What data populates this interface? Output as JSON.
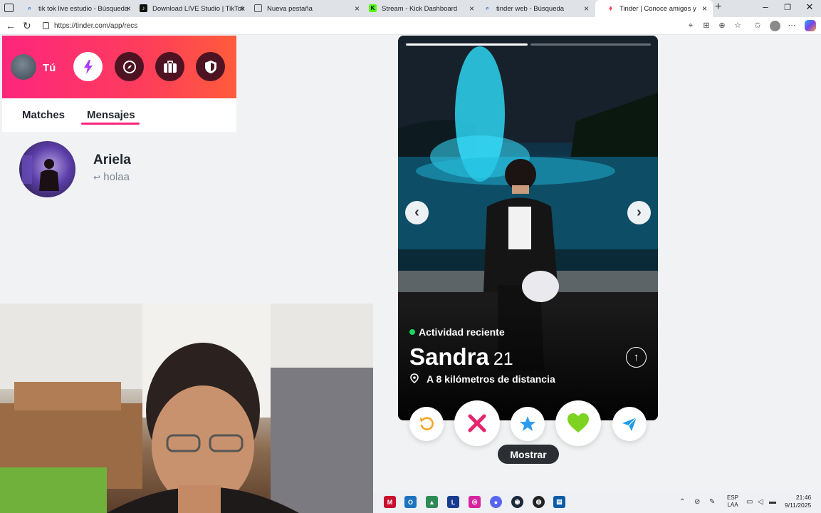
{
  "browser": {
    "tabs": [
      {
        "title": "tik tok live estudio - Búsqueda",
        "icon": "search-icon"
      },
      {
        "title": "Download LIVE Studio | TikTok",
        "icon": "tiktok-icon"
      },
      {
        "title": "Nueva pestaña",
        "icon": "page-icon"
      },
      {
        "title": "Stream - Kick Dashboard",
        "icon": "kick-icon"
      },
      {
        "title": "tinder web - Búsqueda",
        "icon": "search-icon"
      },
      {
        "title": "Tinder | Conoce amigos y gente n",
        "icon": "tinder-icon"
      }
    ],
    "url": "https://tinder.com/app/recs",
    "new_tab": "+",
    "close": "×"
  },
  "sidebar": {
    "user_label": "Tú",
    "tabs": [
      {
        "label": "Matches"
      },
      {
        "label": "Mensajes"
      }
    ],
    "active_tab": "Mensajes",
    "messages": [
      {
        "name": "Ariela",
        "preview": "holaa",
        "reply_icon": "↩"
      }
    ]
  },
  "card": {
    "activity": "Actividad reciente",
    "name": "Sandra",
    "age": "21",
    "distance": "A 8 kilómetros de distancia",
    "photo_index": 1,
    "photo_count": 2,
    "prev_arrow": "‹",
    "next_arrow": "›",
    "info_arrow": "↑"
  },
  "actions": {
    "show_label": "Mostrar"
  },
  "taskbar": {
    "lang_line1": "ESP",
    "lang_line2": "LAA",
    "time": "21:46",
    "date": "9/11/2025"
  },
  "colors": {
    "tinder_gradient_start": "#fd267d",
    "tinder_gradient_end": "#ff5c3b",
    "active_dot": "#1ed760",
    "underline": "#fd267d"
  }
}
